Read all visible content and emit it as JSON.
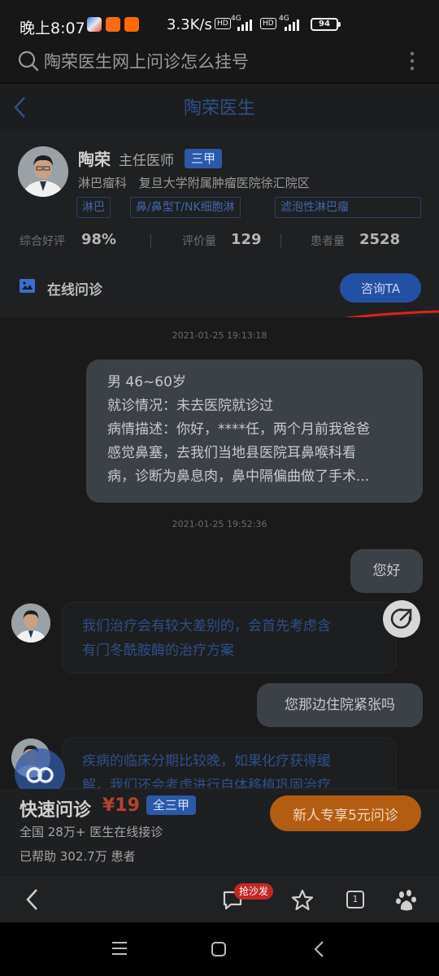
{
  "status_bar": {
    "time": "晚上8:07",
    "speed": "3.3K/s",
    "hd_label": "HD",
    "net_label": "4G",
    "battery": "94"
  },
  "search": {
    "query": "陶荣医生网上问诊怎么挂号"
  },
  "header": {
    "title": "陶荣医生"
  },
  "doctor": {
    "name": "陶荣",
    "title": "主任医师",
    "badge": "三甲",
    "department": "淋巴瘤科",
    "hospital": "复旦大学附属肿瘤医院徐汇院区",
    "tags": [
      "淋巴",
      "鼻/鼻型T/NK细胞淋",
      "滤泡性淋巴瘤"
    ],
    "stats": [
      {
        "label": "综合好评",
        "value": "98%"
      },
      {
        "label": "评价量",
        "value": "129"
      },
      {
        "label": "患者量",
        "value": "2528"
      }
    ]
  },
  "online": {
    "label": "在线问诊",
    "button": "咨询TA"
  },
  "chat": {
    "timestamp1": "2021-01-25 19:13:18",
    "patient_info": [
      "男 46~60岁",
      "就诊情况：未去医院就诊过",
      "病情描述：你好，****任，两个月前我爸爸",
      "感觉鼻塞，去我们当地县医院耳鼻喉科看",
      "病，诊断为鼻息肉，鼻中隔偏曲做了手术..."
    ],
    "timestamp2": "2021-01-25 19:52:36",
    "msg_hello": "您好",
    "doctor_reply1": [
      "我们治疗会有较大差别的，会首先考虑含",
      "有门冬酰胺酶的治疗方案"
    ],
    "msg_hospital": "您那边住院紧张吗",
    "doctor_reply2": [
      "疾病的临床分期比较晚，如果化疗获得缓",
      "解，我们还会考虑进行自体移植巩固治疗"
    ]
  },
  "quick": {
    "title": "快速问诊",
    "price": "¥19",
    "badge": "全三甲",
    "line1": "全国 28万+ 医生在线接诊",
    "line2": "已帮助 302.7万 患者",
    "promo": "新人专享5元问诊"
  },
  "toolbar": {
    "sofa_badge": "抢沙发",
    "tabs_count": "1"
  },
  "colors": {
    "accent_blue": "#2b59a8",
    "price_red": "#b3432f",
    "promo_orange": "#b35d13",
    "annotation_red": "#e0201b"
  }
}
